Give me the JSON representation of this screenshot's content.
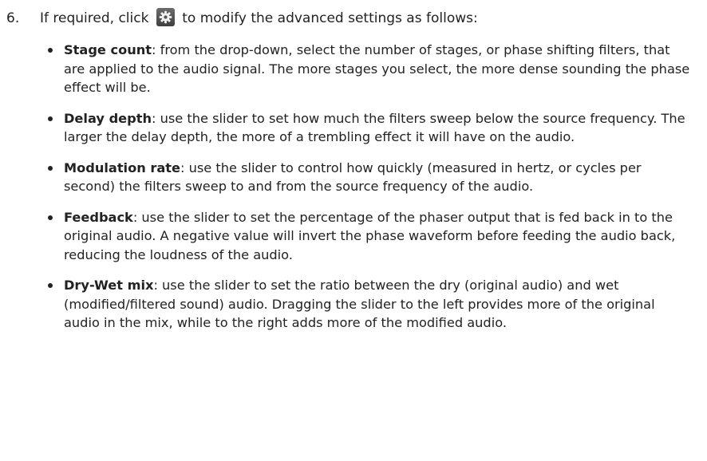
{
  "step": {
    "number": "6.",
    "before_icon": "If required, click",
    "icon": "gear-icon",
    "after_icon": "to modify the advanced settings as follows:"
  },
  "items": [
    {
      "term": "Stage count",
      "text": ": from the drop-down, select the number of stages, or phase shifting filters, that are applied to the audio signal. The more stages you select, the more dense sounding the phase effect will be."
    },
    {
      "term": "Delay depth",
      "text": ": use the slider to set how much the filters sweep below the source frequency. The larger the delay depth, the more of a trembling effect it will have on the audio."
    },
    {
      "term": "Modulation rate",
      "text": ": use the slider to control how quickly (measured in hertz, or cycles per second) the filters sweep to and from the source frequency of the audio."
    },
    {
      "term": "Feedback",
      "text": ": use the slider to set the percentage of the phaser output that is fed back in to the original audio. A negative value will invert the phase waveform before feeding the audio back, reducing the loudness of the audio."
    },
    {
      "term": "Dry-Wet mix",
      "text": ": use the slider to set the ratio between the dry (original audio) and wet (modified/filtered sound) audio. Dragging the slider to the left provides more of the original audio in the mix, while to the right adds more of the modified audio."
    }
  ]
}
